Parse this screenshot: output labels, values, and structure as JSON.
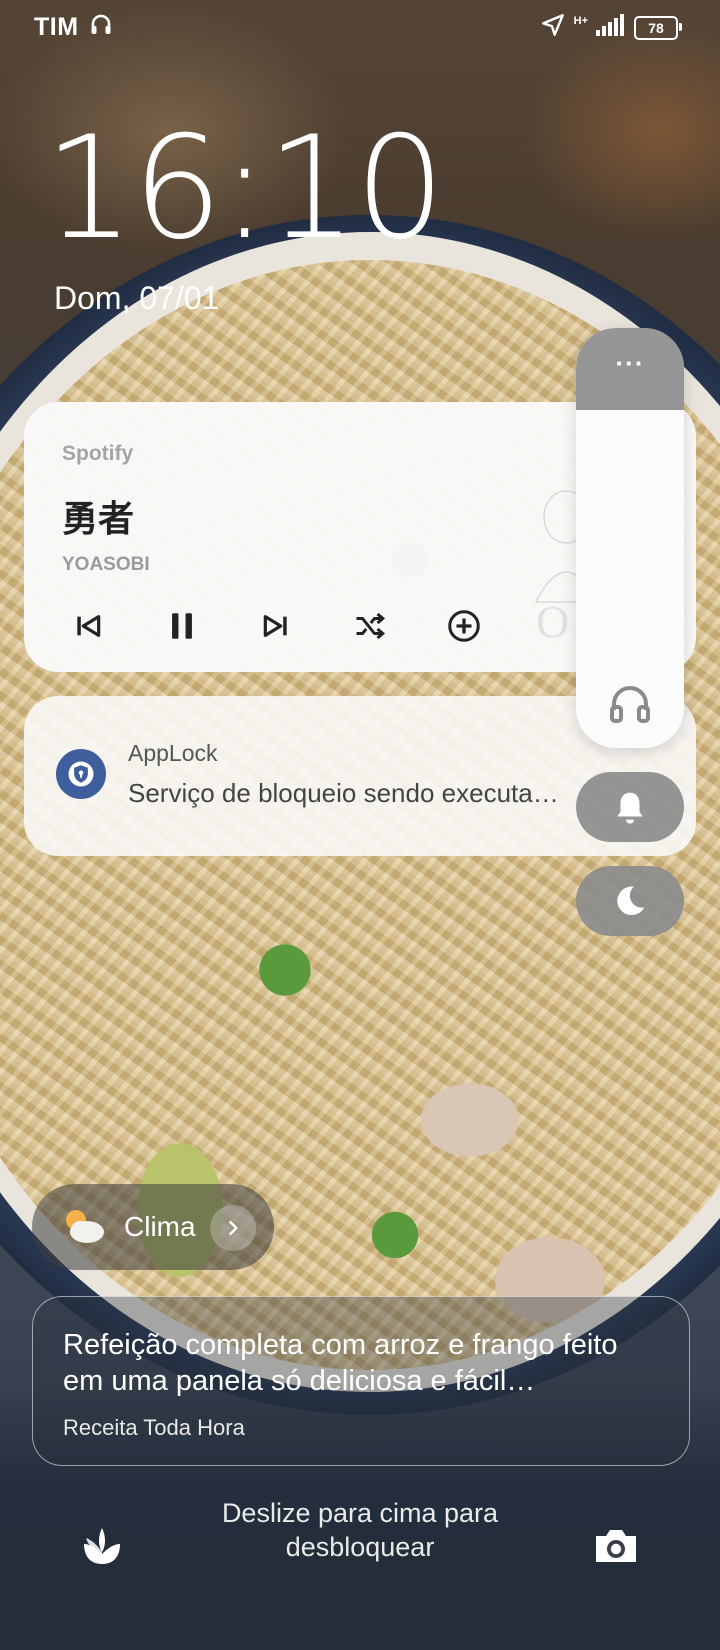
{
  "status_bar": {
    "carrier": "TIM",
    "network_type": "H+",
    "battery": "78"
  },
  "lockscreen": {
    "time": "16:10",
    "date": "Dom, 07/01"
  },
  "media_notification": {
    "app": "Spotify",
    "song": "勇者",
    "artist": "YOASOBI",
    "controls": [
      "previous-icon",
      "pause-icon",
      "next-icon",
      "shuffle-icon",
      "add-icon"
    ]
  },
  "applock_notification": {
    "app": "AppLock",
    "text": "Serviço de bloqueio sendo executa…"
  },
  "volume_panel": {
    "more_label": "···",
    "icons": [
      "headphone-icon",
      "bell-icon",
      "moon-icon"
    ]
  },
  "weather": {
    "label": "Clima"
  },
  "feed": {
    "title": "Refeição completa com arroz e frango feito em uma panela só deliciosa e fácil…",
    "source": "Receita Toda Hora"
  },
  "unlock": {
    "hint_line1": "Deslize para cima para",
    "hint_line2": "desbloquear"
  },
  "colors": {
    "accent_blue": "#3e5f9c",
    "volume_top": "#969696"
  }
}
